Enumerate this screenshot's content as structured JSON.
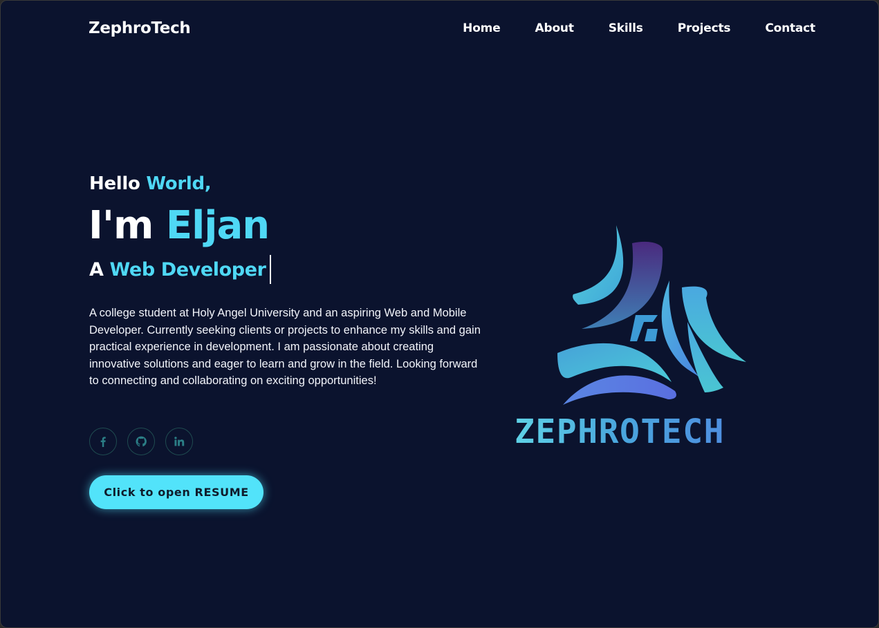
{
  "brand": "ZephroTech",
  "nav": {
    "items": [
      "Home",
      "About",
      "Skills",
      "Projects",
      "Contact"
    ]
  },
  "hero": {
    "hello_prefix": "Hello ",
    "hello_accent": "World,",
    "im_prefix": "I'm ",
    "name": "Eljan",
    "role_prefix": "A ",
    "role": "Web Developer",
    "bio": "A college student at Holy Angel University and an aspiring Web and Mobile Developer. Currently seeking clients or projects to enhance my skills and gain practical experience in development. I am passionate about creating innovative solutions and eager to learn and grow in the field. Looking forward to connecting and collaborating on exciting opportunities!",
    "resume_button": "Click to open RESUME"
  },
  "socials": [
    {
      "icon": "facebook-icon"
    },
    {
      "icon": "github-icon"
    },
    {
      "icon": "linkedin-icon"
    }
  ],
  "logo": {
    "wordmark": "ZEPHROTECH"
  },
  "colors": {
    "background": "#0b132e",
    "accent": "#4fd8f5",
    "button": "#52e3fa",
    "social_border": "#1f4b50",
    "social_icon": "#2b7e86"
  }
}
